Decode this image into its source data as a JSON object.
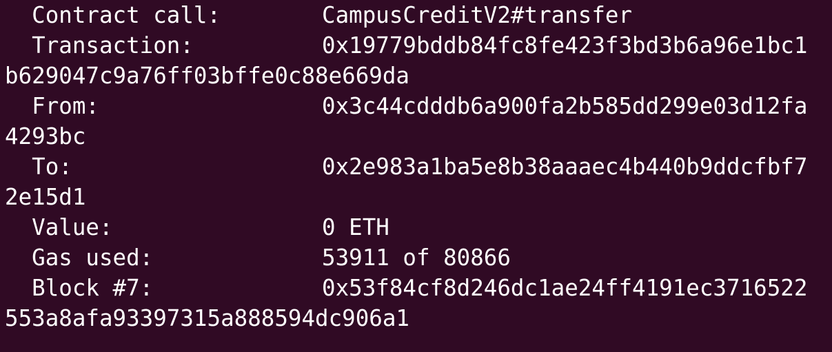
{
  "terminal": {
    "background": "#300a24",
    "foreground": "#ffffff",
    "rows": [
      {
        "label": "  Contract call:",
        "value": "CampusCreditV2#transfer",
        "wrap": ""
      },
      {
        "label": "  Transaction:",
        "value": "0x19779bddb84fc8fe423f3bd3b6a96e1bc1",
        "wrap": "b629047c9a76ff03bffe0c88e669da"
      },
      {
        "label": "  From:",
        "value": "0x3c44cdddb6a900fa2b585dd299e03d12fa",
        "wrap": "4293bc"
      },
      {
        "label": "  To:",
        "value": "0x2e983a1ba5e8b38aaaec4b440b9ddcfbf7",
        "wrap": "2e15d1"
      },
      {
        "label": "  Value:",
        "value": "0 ETH",
        "wrap": ""
      },
      {
        "label": "  Gas used:",
        "value": "53911 of 80866",
        "wrap": ""
      },
      {
        "label": "  Block #7:",
        "value": "0x53f84cf8d246dc1ae24ff4191ec3716522",
        "wrap": "553a8afa93397315a888594dc906a1"
      }
    ]
  }
}
